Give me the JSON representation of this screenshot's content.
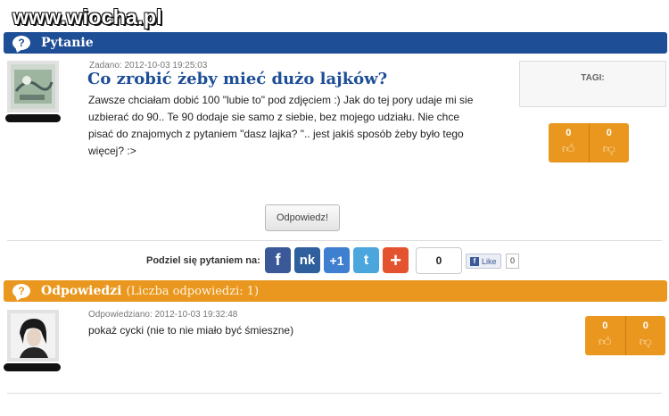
{
  "watermark": "www.wiocha.pl",
  "question_bar": {
    "icon": "question-icon",
    "title": "Pytanie"
  },
  "question": {
    "meta": "Zadano: 2012-10-03 19:25:03",
    "title": "Co zrobić żeby mieć dużo lajków?",
    "lines": [
      "Zawsze chciałam dobić 100 \"lubie to\" pod zdjęciem :) Jak do tej pory udaje mi sie",
      "uzbierać do 90.. Te 90 dodaje sie samo z siebie, bez mojego udziału. Nie chce",
      "pisać do znajomych z pytaniem \"dasz lajka? \".. jest jakiś sposób żeby było tego",
      "więcej? :>"
    ],
    "votes": {
      "up": "0",
      "down": "0"
    }
  },
  "tags": {
    "label": "TAGI:"
  },
  "answer_button": "Odpowiedz!",
  "share": {
    "label": "Podziel się pytaniem na:",
    "networks": [
      {
        "name": "facebook",
        "glyph": "f"
      },
      {
        "name": "nasza-klasa",
        "glyph": "nk"
      },
      {
        "name": "google-plus",
        "glyph": "+1"
      },
      {
        "name": "twitter",
        "glyph": "t"
      },
      {
        "name": "more",
        "glyph": "+"
      }
    ],
    "count": "0",
    "fb_like": "Like",
    "fb_like_count": "0"
  },
  "answers_bar": {
    "icon": "question-icon",
    "title": "Odpowiedzi",
    "count_text": "(Liczba odpowiedzi: 1)"
  },
  "answer": {
    "meta": "Odpowiedziano: 2012-10-03 19:32:48",
    "text": "pokaż cycki (nie to nie miało być śmieszne)",
    "votes": {
      "up": "0",
      "down": "0"
    }
  },
  "colors": {
    "brand_blue": "#1d4e96",
    "brand_orange": "#e9971e"
  }
}
